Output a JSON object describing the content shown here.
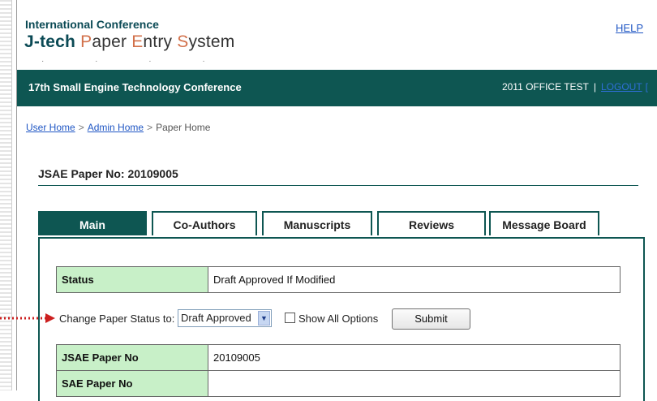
{
  "header": {
    "line1": "International Conference",
    "brand_bold": "J-tech",
    "brand_p": "P",
    "brand_aper": "aper ",
    "brand_e": "E",
    "brand_ntry": "ntry ",
    "brand_s": "S",
    "brand_ystem": "ystem",
    "help_link": "HELP"
  },
  "banner": {
    "title": "17th Small Engine Technology Conference",
    "user_label": "2011 OFFICE TEST",
    "separator": "|",
    "logout_link": "LOGOUT",
    "trailing": "["
  },
  "breadcrumb": {
    "items": [
      "User Home",
      "Admin Home",
      "Paper Home"
    ],
    "separator": ">"
  },
  "paper": {
    "title": "JSAE Paper No: 20109005"
  },
  "tabs": [
    {
      "label": "Main",
      "active": true
    },
    {
      "label": "Co-Authors",
      "active": false
    },
    {
      "label": "Manuscripts",
      "active": false
    },
    {
      "label": "Reviews",
      "active": false
    },
    {
      "label": "Message Board",
      "active": false
    }
  ],
  "status_row": {
    "label": "Status",
    "value": "Draft Approved If Modified"
  },
  "change_status": {
    "label": "Change Paper Status to:",
    "selected_value": "Draft Approved",
    "show_all_label": "Show All Options",
    "submit_label": "Submit"
  },
  "detail_rows": [
    {
      "label": "JSAE Paper No",
      "value": "20109005"
    },
    {
      "label": "SAE Paper No",
      "value": ""
    }
  ],
  "colors": {
    "brand_teal": "#0e5652",
    "label_green": "#c8f0c8",
    "link_blue": "#1f56c4",
    "arrow_red": "#cc1f1f"
  }
}
